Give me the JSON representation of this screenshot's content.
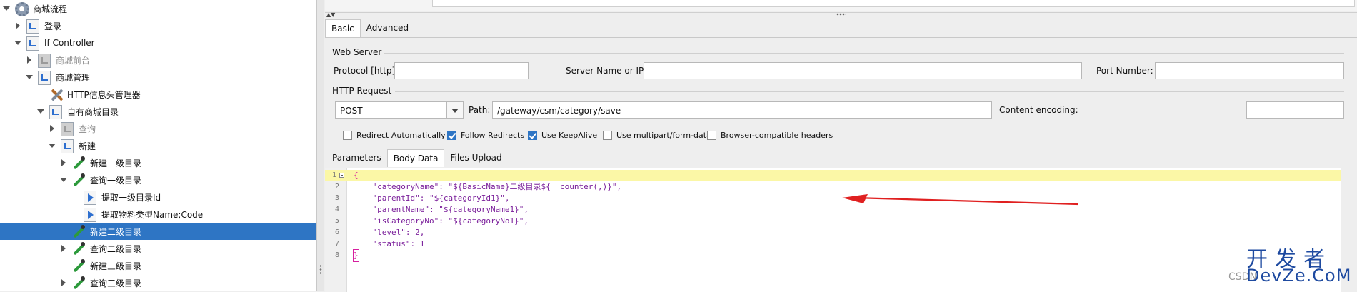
{
  "tree": {
    "items": [
      {
        "label": "商城流程",
        "icon": "gear",
        "toggle": "expanded",
        "level": 0,
        "state": "normal"
      },
      {
        "label": "登录",
        "icon": "page",
        "toggle": "collapsed",
        "level": 1,
        "state": "normal"
      },
      {
        "label": "If Controller",
        "icon": "page",
        "toggle": "expanded",
        "level": 1,
        "state": "normal"
      },
      {
        "label": "商城前台",
        "icon": "page-grey",
        "toggle": "collapsed",
        "level": 2,
        "state": "disabled"
      },
      {
        "label": "商城管理",
        "icon": "page",
        "toggle": "expanded",
        "level": 2,
        "state": "normal"
      },
      {
        "label": "HTTP信息头管理器",
        "icon": "tools",
        "toggle": "none",
        "level": 3,
        "state": "normal"
      },
      {
        "label": "自有商城目录",
        "icon": "page",
        "toggle": "expanded",
        "level": 3,
        "state": "normal"
      },
      {
        "label": "查询",
        "icon": "page-grey",
        "toggle": "collapsed",
        "level": 4,
        "state": "disabled"
      },
      {
        "label": "新建",
        "icon": "page",
        "toggle": "expanded",
        "level": 4,
        "state": "normal"
      },
      {
        "label": "新建一级目录",
        "icon": "pipette",
        "toggle": "collapsed",
        "level": 5,
        "state": "normal"
      },
      {
        "label": "查询一级目录",
        "icon": "pipette",
        "toggle": "expanded",
        "level": 5,
        "state": "normal"
      },
      {
        "label": "提取一级目录Id",
        "icon": "extract",
        "toggle": "none",
        "level": 6,
        "state": "normal"
      },
      {
        "label": "提取物料类型Name;Code",
        "icon": "extract",
        "toggle": "none",
        "level": 6,
        "state": "normal"
      },
      {
        "label": "新建二级目录",
        "icon": "pipette",
        "toggle": "none",
        "level": 5,
        "state": "selected"
      },
      {
        "label": "查询二级目录",
        "icon": "pipette",
        "toggle": "collapsed",
        "level": 5,
        "state": "normal"
      },
      {
        "label": "新建三级目录",
        "icon": "pipette",
        "toggle": "none",
        "level": 5,
        "state": "normal"
      },
      {
        "label": "查询三级目录",
        "icon": "pipette",
        "toggle": "collapsed",
        "level": 5,
        "state": "normal"
      }
    ]
  },
  "main_tabs": [
    "Basic",
    "Advanced"
  ],
  "web_server": {
    "title": "Web Server",
    "protocol_label": "Protocol [http]:",
    "protocol_value": "",
    "server_label": "Server Name or IP:",
    "server_value": "",
    "port_label": "Port Number:",
    "port_value": ""
  },
  "http_request": {
    "title": "HTTP Request",
    "method": "POST",
    "path_label": "Path:",
    "path_value": "/gateway/csm/category/save",
    "encoding_label": "Content encoding:",
    "encoding_value": ""
  },
  "checkboxes": [
    {
      "label": "Redirect Automatically",
      "checked": false
    },
    {
      "label": "Follow Redirects",
      "checked": true
    },
    {
      "label": "Use KeepAlive",
      "checked": true
    },
    {
      "label": "Use multipart/form-data",
      "checked": false
    },
    {
      "label": "Browser-compatible headers",
      "checked": false
    }
  ],
  "sub_tabs": [
    "Parameters",
    "Body Data",
    "Files Upload"
  ],
  "active_sub_tab": "Body Data",
  "editor": {
    "lines": [
      {
        "n": "1",
        "text": "{"
      },
      {
        "n": "2",
        "text": "    \"categoryName\": \"${BasicName}二级目录${__counter(,)}\","
      },
      {
        "n": "3",
        "text": "    \"parentId\": \"${categoryId1}\","
      },
      {
        "n": "4",
        "text": "    \"parentName\": \"${categoryName1}\","
      },
      {
        "n": "5",
        "text": "    \"isCategoryNo\": \"${categoryNo1}\","
      },
      {
        "n": "6",
        "text": "    \"level\": 2,"
      },
      {
        "n": "7",
        "text": "    \"status\": 1"
      },
      {
        "n": "8",
        "text": "}"
      }
    ]
  },
  "watermark": {
    "cn": "开发者",
    "en": "DevZe.CoM",
    "csdn": "CSDN"
  },
  "colors": {
    "selection": "#2e75c4",
    "current_line": "#fbf7a6",
    "annotation_arrow": "#e02020"
  }
}
